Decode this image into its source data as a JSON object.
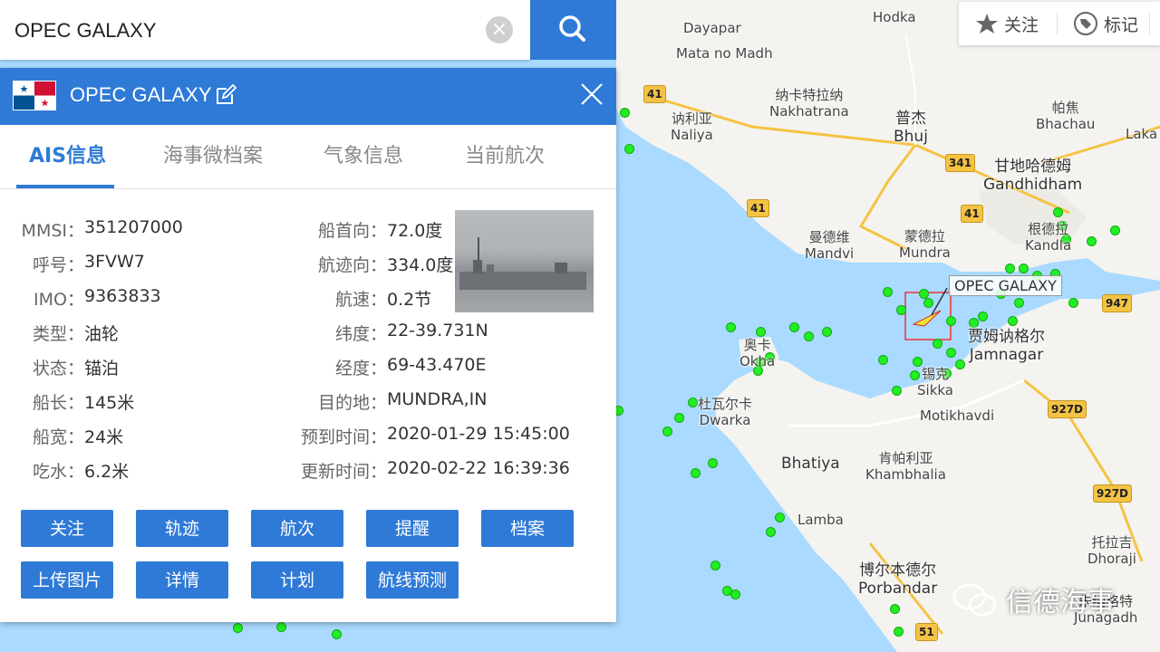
{
  "search": {
    "value": "OPEC GALAXY"
  },
  "toolbar": {
    "follow_label": "关注",
    "mark_label": "标记"
  },
  "panel": {
    "title": "OPEC GALAXY",
    "tabs": [
      "AIS信息",
      "海事微档案",
      "气象信息",
      "当前航次"
    ],
    "left_rows": [
      {
        "label": "MMSI：",
        "value": "351207000"
      },
      {
        "label": "呼号：",
        "value": "3FVW7"
      },
      {
        "label": "IMO：",
        "value": "9363833"
      },
      {
        "label": "类型：",
        "value": "油轮"
      },
      {
        "label": "状态：",
        "value": "锚泊"
      },
      {
        "label": "船长：",
        "value": "145米"
      },
      {
        "label": "船宽：",
        "value": "24米"
      },
      {
        "label": "吃水：",
        "value": "6.2米"
      }
    ],
    "right_rows": [
      {
        "label": "船首向：",
        "value": "72.0度"
      },
      {
        "label": "航迹向：",
        "value": "334.0度"
      },
      {
        "label": "航速：",
        "value": "0.2节"
      },
      {
        "label": "纬度：",
        "value": "22-39.731N"
      },
      {
        "label": "经度：",
        "value": "69-43.470E"
      },
      {
        "label": "目的地：",
        "value": "MUNDRA,IN"
      },
      {
        "label": "预到时间：",
        "value": "2020-01-29 15:45:00"
      },
      {
        "label": "更新时间：",
        "value": "2020-02-22 16:39:36"
      }
    ],
    "buttons": [
      "关注",
      "轨迹",
      "航次",
      "提醒",
      "档案",
      "上传图片",
      "详情",
      "计划",
      "航线预测"
    ]
  },
  "map": {
    "target_label": "OPEC GALAXY",
    "places": [
      {
        "zh": "",
        "en": "Hodka"
      },
      {
        "zh": "",
        "en": "Dayapar"
      },
      {
        "zh": "",
        "en": "Mata no Madh"
      },
      {
        "zh": "纳卡特拉纳",
        "en": "Nakhatrana"
      },
      {
        "zh": "讷利亚",
        "en": "Naliya"
      },
      {
        "zh": "普杰",
        "en": "Bhuj"
      },
      {
        "zh": "帕焦",
        "en": "Bhachau"
      },
      {
        "zh": "甘地哈德姆",
        "en": "Gandhidham"
      },
      {
        "zh": "曼德维",
        "en": "Mandvi"
      },
      {
        "zh": "蒙德拉",
        "en": "Mundra"
      },
      {
        "zh": "根德拉",
        "en": "Kandla"
      },
      {
        "zh": "贾姆讷格尔",
        "en": "Jamnagar"
      },
      {
        "zh": "奥卡",
        "en": "Okha"
      },
      {
        "zh": "锡克",
        "en": "Sikka"
      },
      {
        "zh": "杜瓦尔卡",
        "en": "Dwarka"
      },
      {
        "zh": "",
        "en": "Motikhavdi"
      },
      {
        "zh": "",
        "en": "Bhatiya"
      },
      {
        "zh": "肯帕利亚",
        "en": "Khambhalia"
      },
      {
        "zh": "",
        "en": "Lamba"
      },
      {
        "zh": "博尔本德尔",
        "en": "Porbandar"
      },
      {
        "zh": "托拉吉",
        "en": "Dhoraji"
      },
      {
        "zh": "",
        "en": "Laka"
      },
      {
        "zh": "朱纳格特",
        "en": "Junagadh"
      }
    ],
    "roads": [
      "41",
      "41",
      "41",
      "341",
      "947",
      "927D",
      "927D",
      "51"
    ]
  },
  "watermark": "信德海事"
}
